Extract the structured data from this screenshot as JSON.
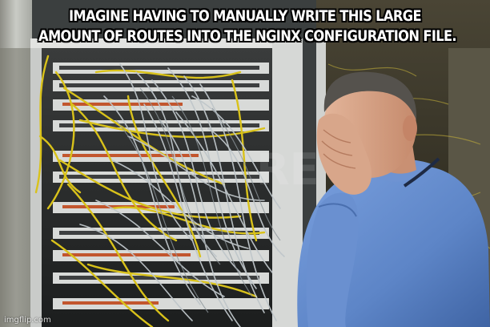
{
  "meme": {
    "caption_lines": [
      "IMAGINE HAVING TO MANUALLY WRITE THIS LARGE",
      "AMOUNT OF ROUTES INTO THE NGINX CONFIGURATION FILE."
    ],
    "watermark": "imgflip.com"
  },
  "scene": {
    "subject": "man-facepalming",
    "background": "server-rack-with-tangled-cables"
  },
  "colors": {
    "caption_text": "#ffffff",
    "caption_outline": "#000000",
    "cable_yellow": "#d9c21a",
    "cable_grey": "#bfc6ca",
    "shirt_blue": "#5f86c8",
    "rack_grey": "#c7c9c8"
  }
}
